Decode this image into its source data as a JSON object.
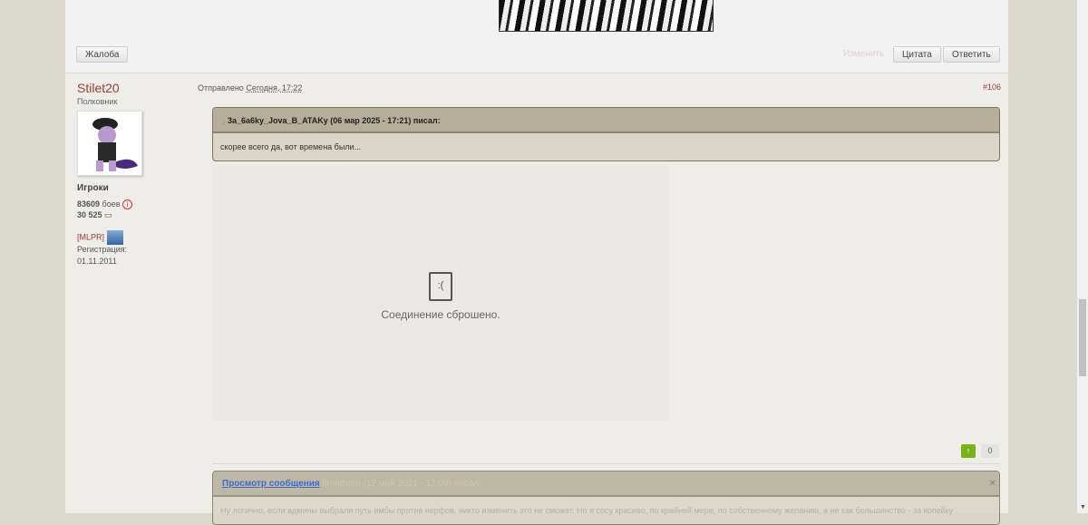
{
  "top": {
    "complain": "Жалоба",
    "edit": "Изменить",
    "quote": "Цитата",
    "reply": "Ответить"
  },
  "post": {
    "author": "Stilet20",
    "rank": "Полковник",
    "group": "Игроки",
    "battles_num": "83609",
    "battles_label": "боев",
    "posts": "30 525",
    "clan": "[MLPR]",
    "reg_label": "Регистрация:",
    "reg_date": "01.11.2011",
    "sent_label": "Отправлено",
    "sent_time": "Сегодня, 17:22",
    "number": "#106",
    "quote1": {
      "header": "3a_6a6ky_Jova_B_ATAKy (06 мар 2025 - 17:21) писал:",
      "body": "скорее всего да, вот времена были..."
    },
    "error": "Соединение сброшено.",
    "rep": "0",
    "quote2": {
      "link": "Просмотр сообщения",
      "header": "Ilrenthorn (17 май 2021 - 12:09) писал:",
      "body": "Ну логично, если админы выбрали путь имбы против нерфов, никто изменить это не сможет. Но я сосу красиво, по крайней мере, по собственному желанию, а не как большинство - за копейку"
    }
  },
  "colors": {
    "author": "#9c3c33",
    "quote_header": "#b5af99",
    "plus": "#7ab317"
  }
}
